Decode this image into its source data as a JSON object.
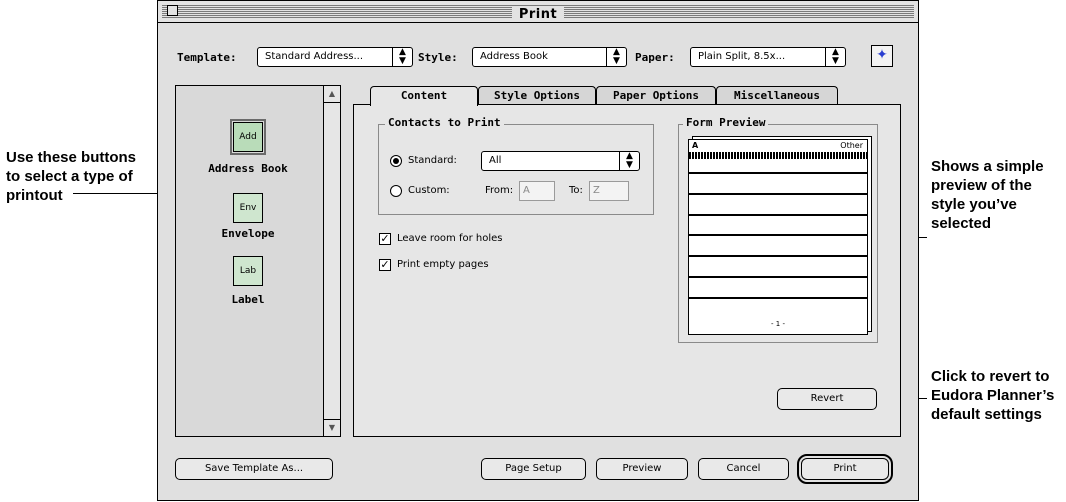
{
  "callouts": {
    "left": [
      "Use these buttons",
      "to select a type of",
      "printout"
    ],
    "right_top": [
      "Shows a simple",
      "preview of the",
      "style you’ve",
      "selected"
    ],
    "right_bottom": [
      "Click to revert to",
      "Eudora Planner’s",
      "default settings"
    ]
  },
  "window": {
    "title": "Print"
  },
  "top_controls": {
    "template_label": "Template:",
    "template_value": "Standard Address...",
    "style_label": "Style:",
    "style_value": "Address Book",
    "paper_label": "Paper:",
    "paper_value": "Plain Split, 8.5x...",
    "help_icon": "compass-help-icon"
  },
  "print_types": [
    {
      "icon_text": "Add",
      "label": "Address Book",
      "selected": true
    },
    {
      "icon_text": "Env",
      "label": "Envelope",
      "selected": false
    },
    {
      "icon_text": "Lab",
      "label": "Label",
      "selected": false
    }
  ],
  "tabs": [
    "Content",
    "Style Options",
    "Paper Options",
    "Miscellaneous"
  ],
  "active_tab": "Content",
  "contacts": {
    "title": "Contacts to Print",
    "standard_label": "Standard:",
    "standard_value": "All",
    "custom_label": "Custom:",
    "from_label": "From:",
    "from_value": "A",
    "to_label": "To:",
    "to_value": "Z",
    "selected": "standard"
  },
  "options": {
    "leave_room": {
      "label": "Leave room for holes",
      "checked": true
    },
    "print_empty": {
      "label": "Print empty pages",
      "checked": true
    }
  },
  "preview": {
    "title": "Form Preview",
    "header_left": "A",
    "header_right": "Other",
    "page_number": "- 1 -"
  },
  "buttons": {
    "revert": "Revert",
    "save_template": "Save Template As...",
    "page_setup": "Page Setup",
    "preview": "Preview",
    "cancel": "Cancel",
    "print": "Print"
  }
}
